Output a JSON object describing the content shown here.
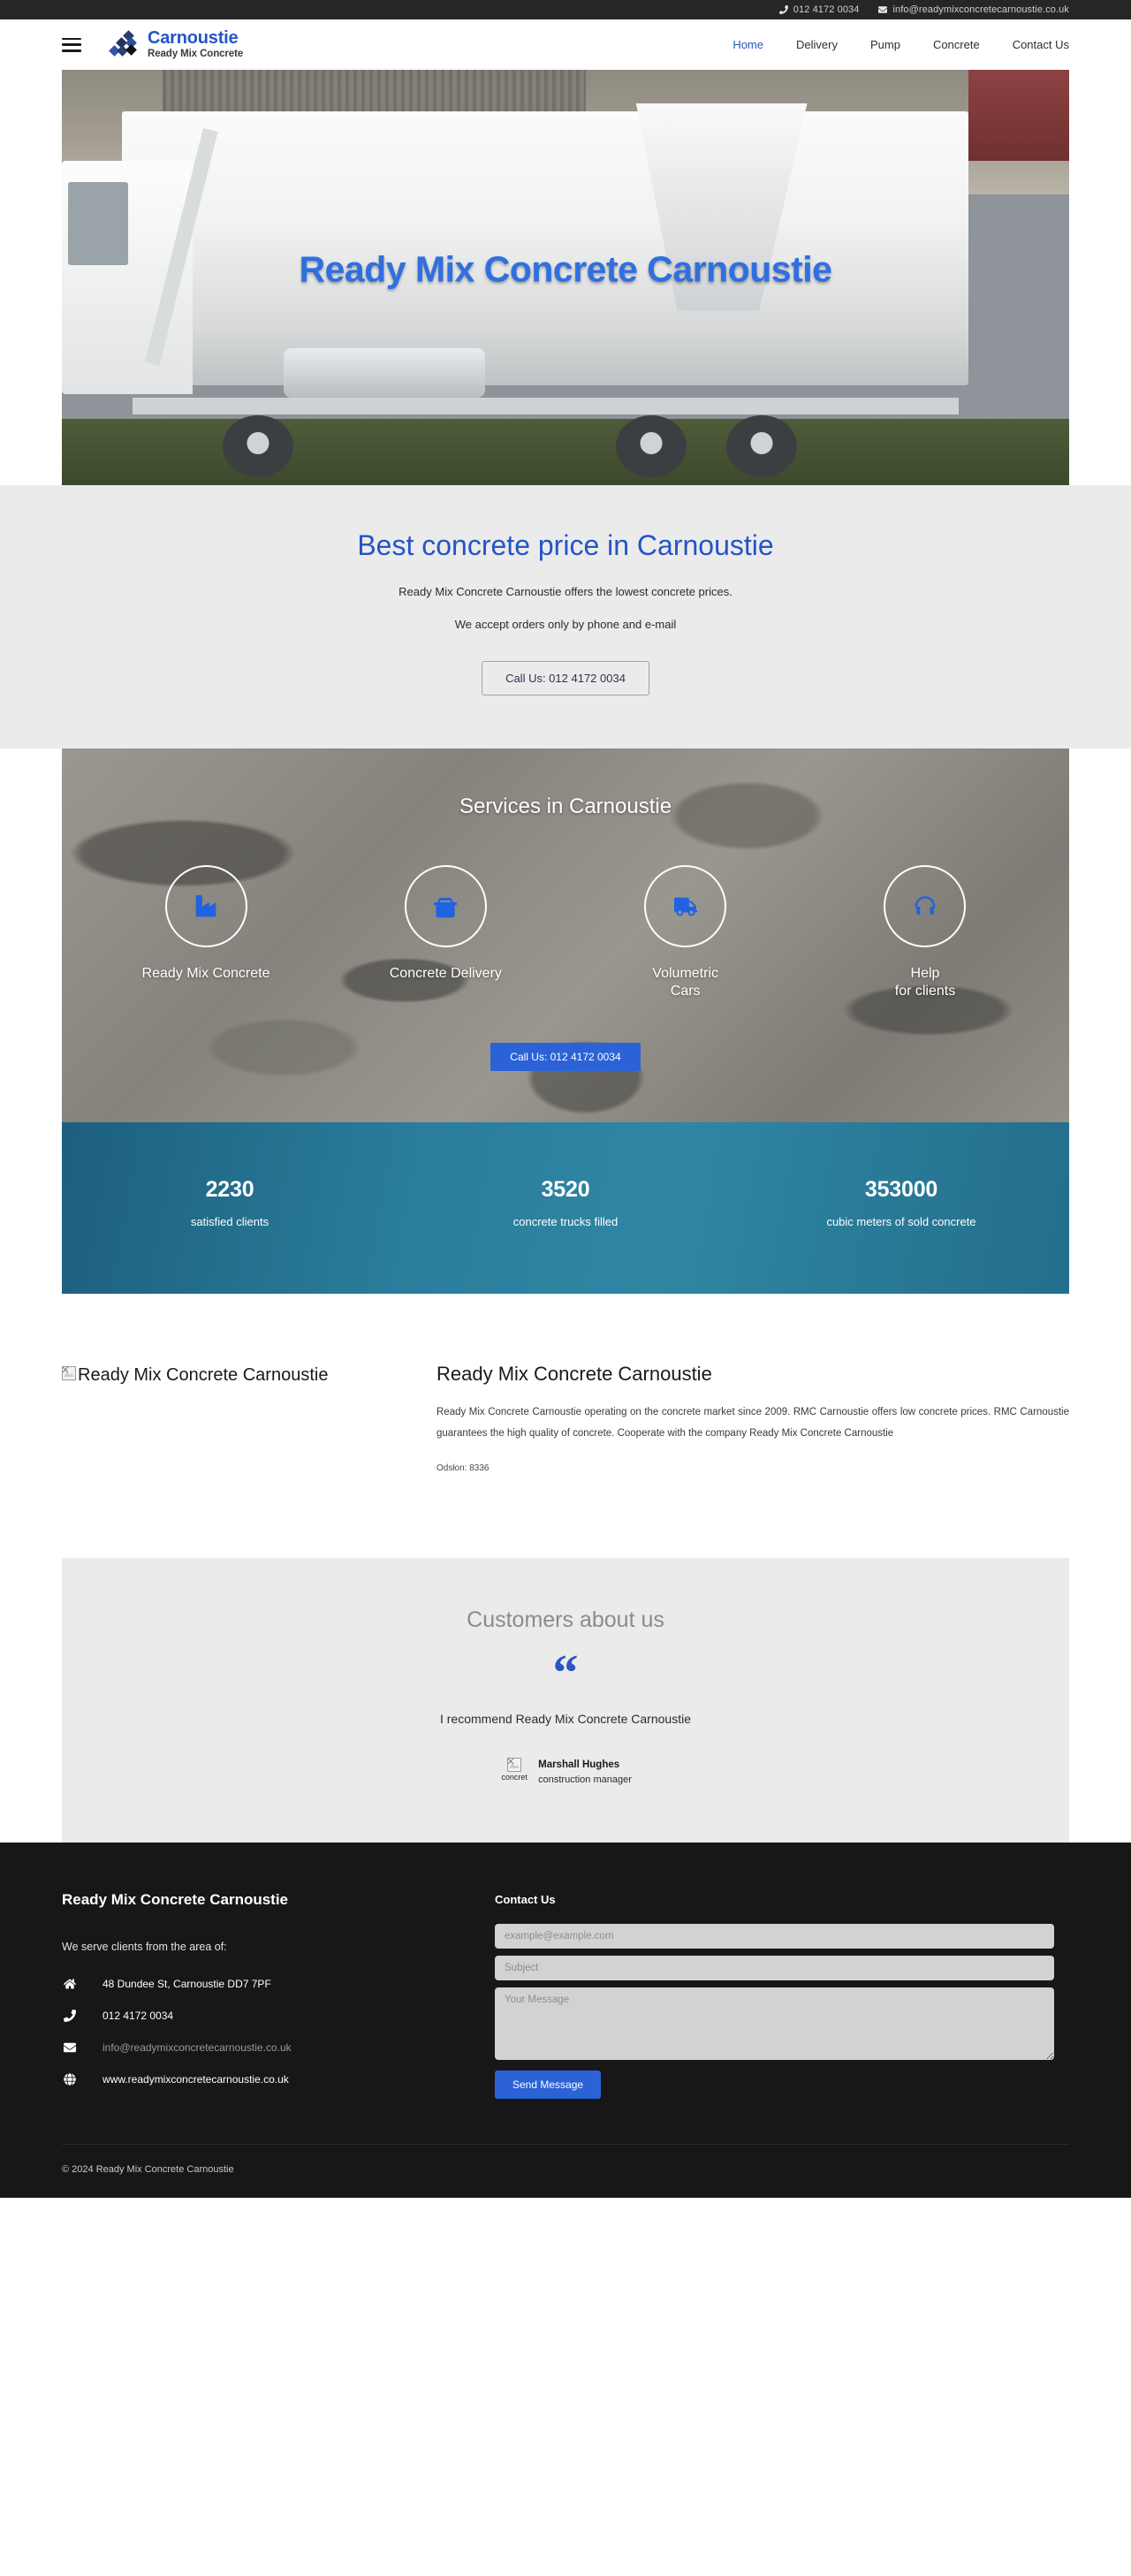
{
  "topbar": {
    "phone": "012 4172 0034",
    "email": "info@readymixconcretecarnoustie.co.uk",
    "phone_icon": "phone-icon",
    "email_icon": "envelope-icon"
  },
  "header": {
    "menu_icon": "hamburger-menu-icon",
    "logo_icon": "diamond-blocks-logo-icon",
    "brand_title": "Carnoustie",
    "brand_subtitle": "Ready Mix Concrete",
    "nav": [
      {
        "label": "Home",
        "active": true
      },
      {
        "label": "Delivery",
        "active": false
      },
      {
        "label": "Pump",
        "active": false
      },
      {
        "label": "Concrete",
        "active": false
      },
      {
        "label": "Contact Us",
        "active": false
      }
    ]
  },
  "hero": {
    "overlay_title": "Ready Mix Concrete Carnoustie"
  },
  "price": {
    "title": "Best concrete price in Carnoustie",
    "line1": "Ready Mix Concrete Carnoustie offers the lowest concrete prices.",
    "line2": "We accept orders only by phone and e-mail",
    "cta": "Call Us: 012 4172 0034"
  },
  "services": {
    "title": "Services in Carnoustie",
    "items": [
      {
        "label": "Ready Mix Concrete",
        "icon": "industry-icon"
      },
      {
        "label": "Concrete Delivery",
        "icon": "truck-icon"
      },
      {
        "label": "Volumetric\nCars",
        "icon": "truck-moving-icon"
      },
      {
        "label": "Help\nfor clients",
        "icon": "headset-icon"
      }
    ],
    "cta": "Call Us: 012 4172 0034"
  },
  "stats": [
    {
      "number": "2230",
      "label": "satisfied clients"
    },
    {
      "number": "3520",
      "label": "concrete trucks filled"
    },
    {
      "number": "353000",
      "label": "cubic meters of sold concrete"
    }
  ],
  "about": {
    "image_alt": "Ready Mix Concrete Carnoustie",
    "image_icon": "broken-image-icon",
    "title": "Ready Mix Concrete Carnoustie",
    "body": "Ready Mix Concrete Carnoustie operating on the concrete market since 2009. RMC Carnoustie offers low concrete prices. RMC Carnoustie guarantees the high quality of concrete. Cooperate with the company Ready Mix Concrete Carnoustie",
    "meta": "Odsłon: 8336"
  },
  "testimonials": {
    "title": "Customers about us",
    "quote_icon": "quotation-mark-icon",
    "quote": "I recommend Ready Mix Concrete Carnoustie",
    "avatar_icon": "broken-image-icon",
    "avatar_alt": "concret",
    "author_name": "Marshall Hughes",
    "author_role": "construction manager"
  },
  "footer": {
    "heading": "Ready Mix Concrete Carnoustie",
    "subheading": "We serve clients from the area of:",
    "contacts": [
      {
        "icon": "home-icon",
        "text": "48 Dundee St, Carnoustie DD7 7PF",
        "muted": false
      },
      {
        "icon": "phone-icon",
        "text": "012 4172 0034",
        "muted": false
      },
      {
        "icon": "envelope-icon",
        "text": "info@readymixconcretecarnoustie.co.uk",
        "muted": true
      },
      {
        "icon": "globe-icon",
        "text": "www.readymixconcretecarnoustie.co.uk",
        "muted": false
      }
    ],
    "form": {
      "heading": "Contact Us",
      "email_placeholder": "example@example.com",
      "subject_placeholder": "Subject",
      "message_placeholder": "Your Message",
      "submit_label": "Send Message"
    },
    "copyright": "© 2024 Ready Mix Concrete Carnoustie"
  },
  "colors": {
    "brand_blue": "#2554c7",
    "accent_blue": "#2b62d6",
    "dark": "#171717",
    "stats_teal": "#2a7d9c"
  }
}
